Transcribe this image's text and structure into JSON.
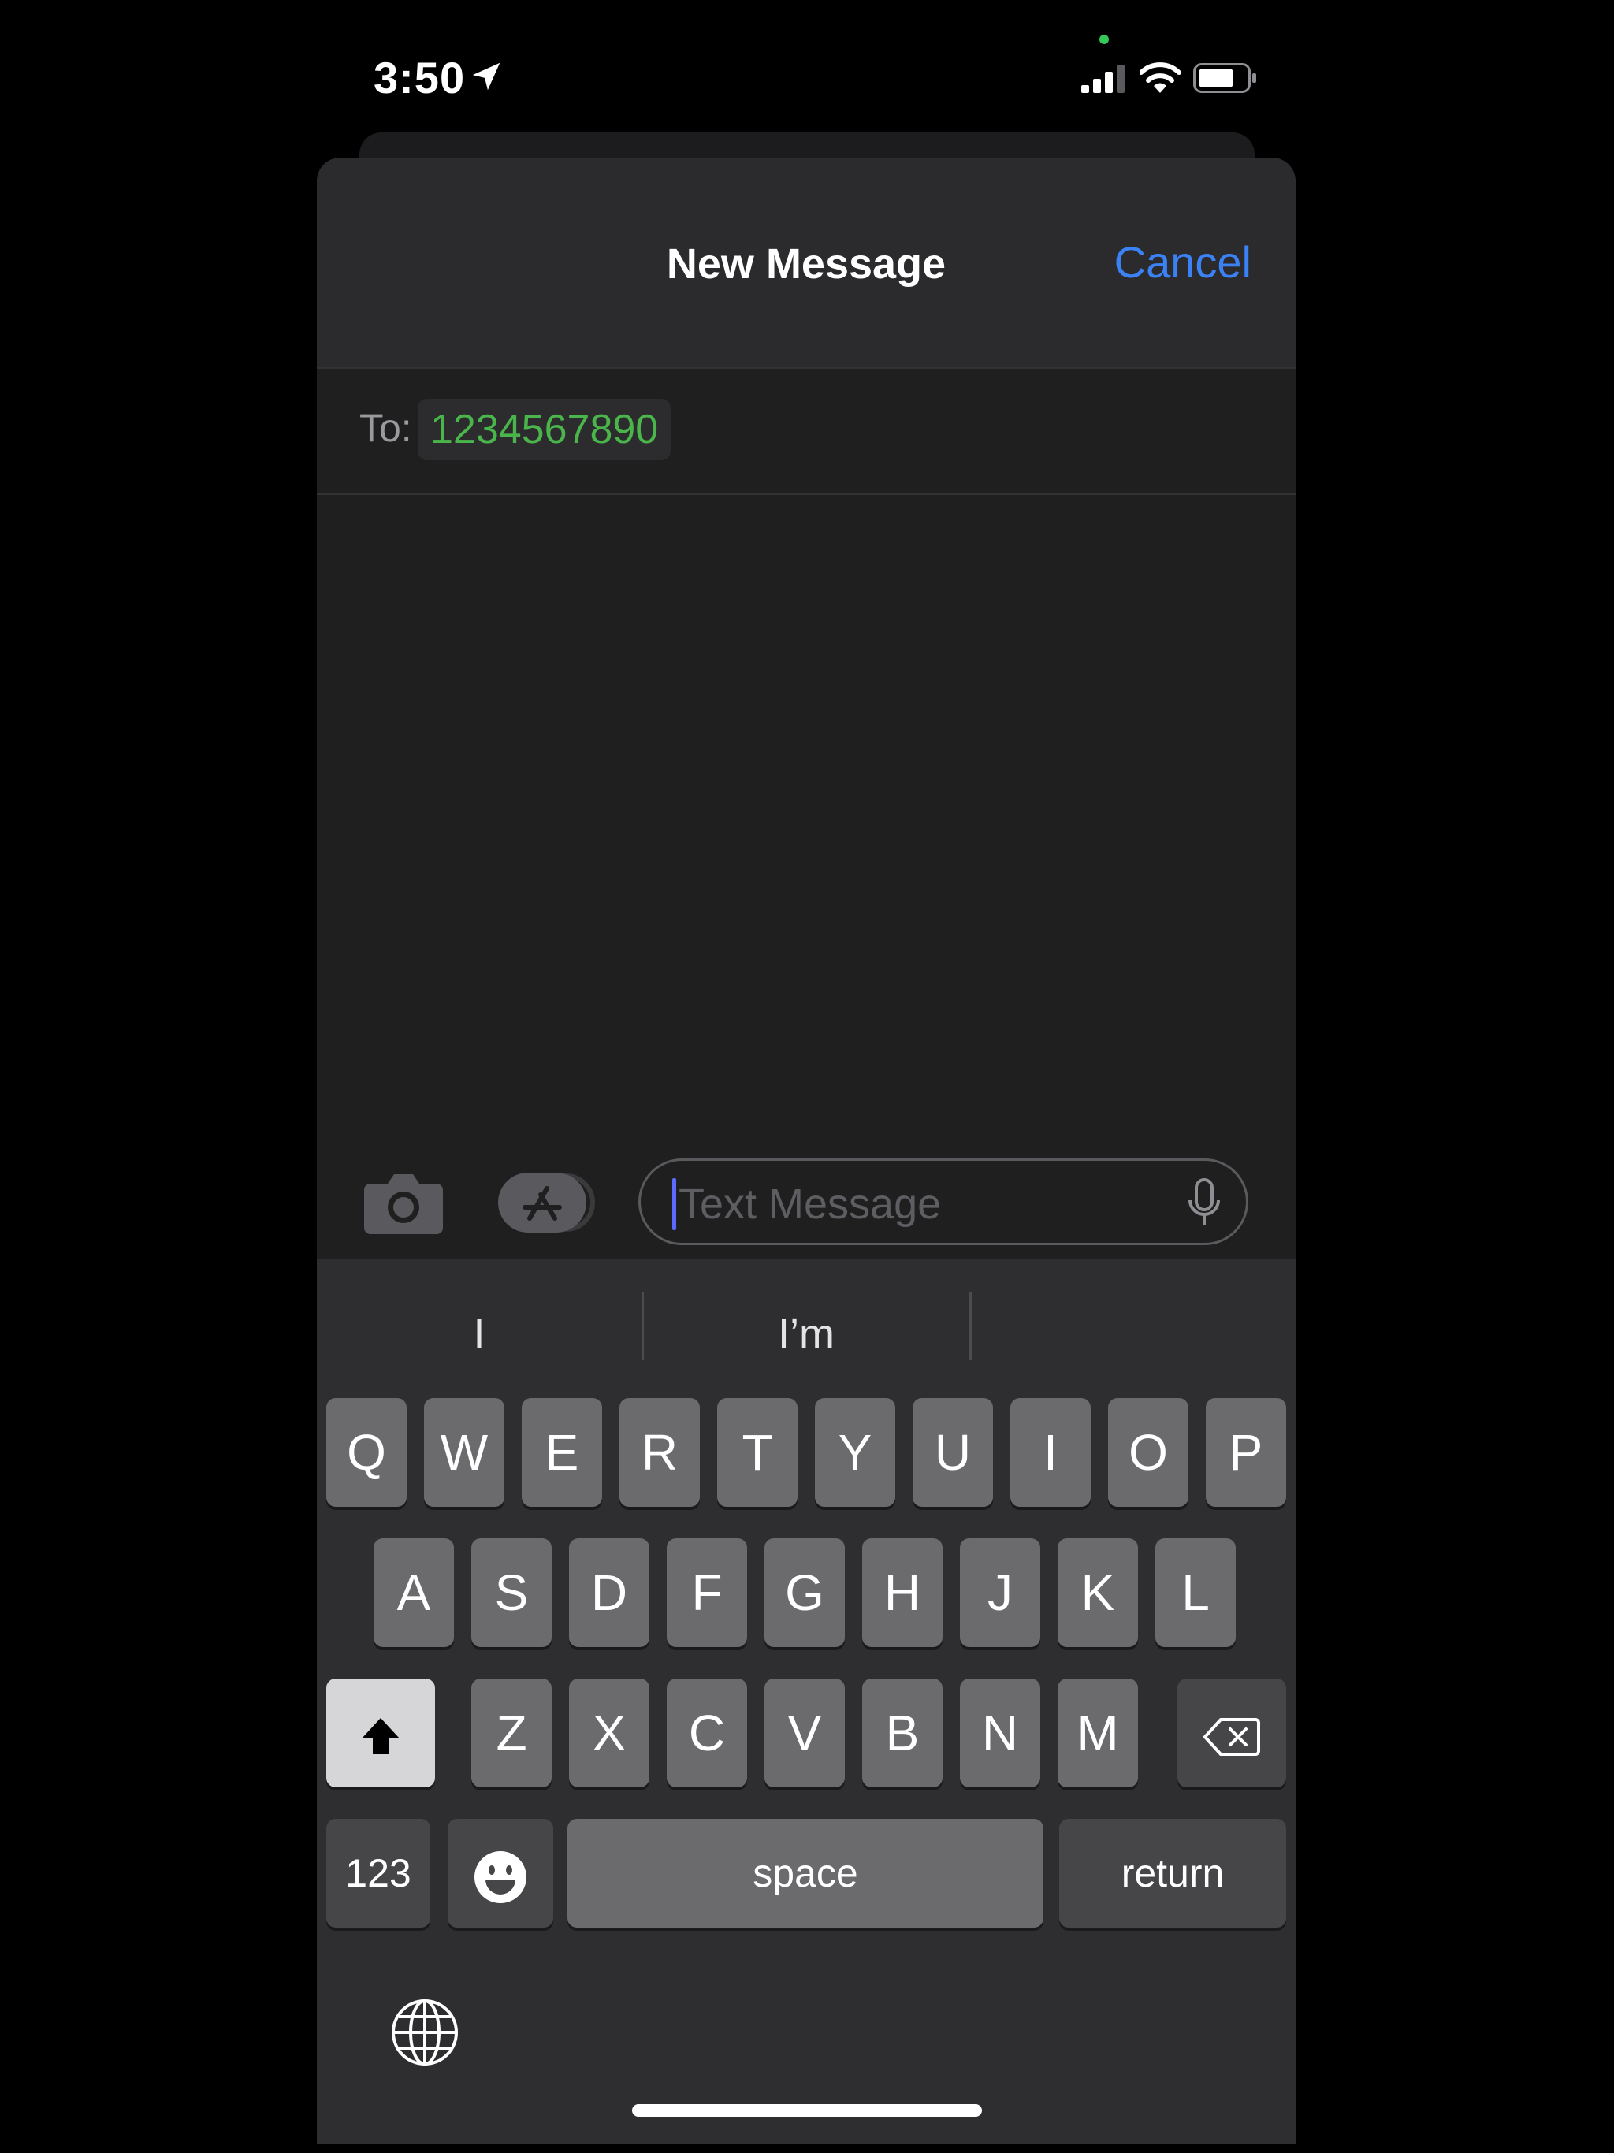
{
  "status_bar": {
    "time": "3:50"
  },
  "compose": {
    "title": "New Message",
    "cancel": "Cancel",
    "to_label": "To:",
    "recipient": "1234567890",
    "placeholder": "Text Message"
  },
  "keyboard": {
    "suggestions": [
      "I",
      "I’m",
      ""
    ],
    "row1": [
      "Q",
      "W",
      "E",
      "R",
      "T",
      "Y",
      "U",
      "I",
      "O",
      "P"
    ],
    "row2": [
      "A",
      "S",
      "D",
      "F",
      "G",
      "H",
      "J",
      "K",
      "L"
    ],
    "row3": [
      "Z",
      "X",
      "C",
      "V",
      "B",
      "N",
      "M"
    ],
    "numbers_key": "123",
    "space_key": "space",
    "return_key": "return"
  },
  "colors": {
    "accent": "#3b82f6",
    "recipient": "#4ab54a",
    "background": "#000000"
  },
  "icons": [
    "location-arrow-icon",
    "cellular-signal-icon",
    "wifi-icon",
    "battery-icon",
    "camera-icon",
    "app-store-icon",
    "microphone-icon",
    "shift-icon",
    "delete-icon",
    "emoji-icon",
    "globe-icon"
  ]
}
